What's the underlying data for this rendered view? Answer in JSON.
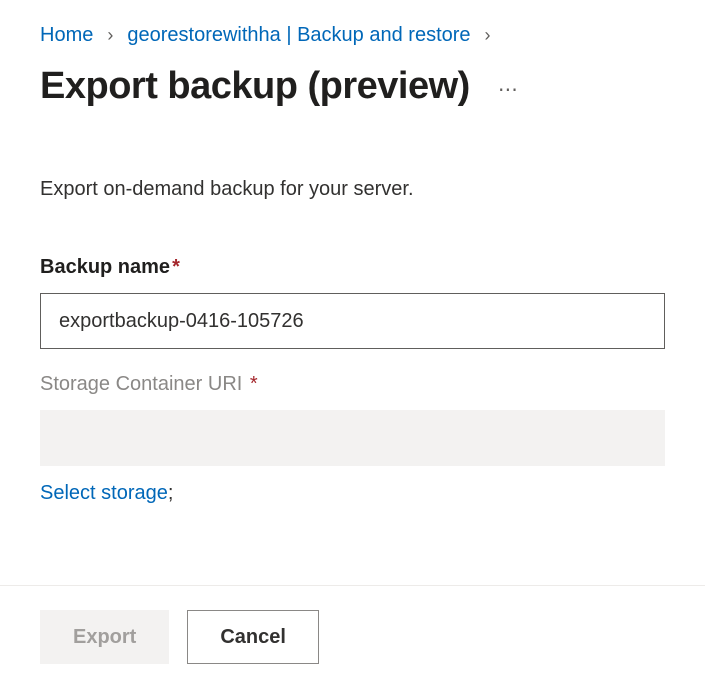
{
  "breadcrumb": {
    "home": "Home",
    "resource": "georestorewithha | Backup and restore"
  },
  "page": {
    "title": "Export backup (preview)",
    "description": "Export on-demand backup for your server."
  },
  "fields": {
    "backupName": {
      "label": "Backup name",
      "value": "exportbackup-0416-105726"
    },
    "storageUri": {
      "label": "Storage Container URI",
      "value": ""
    }
  },
  "links": {
    "selectStorage": "Select storage"
  },
  "buttons": {
    "export": "Export",
    "cancel": "Cancel"
  }
}
